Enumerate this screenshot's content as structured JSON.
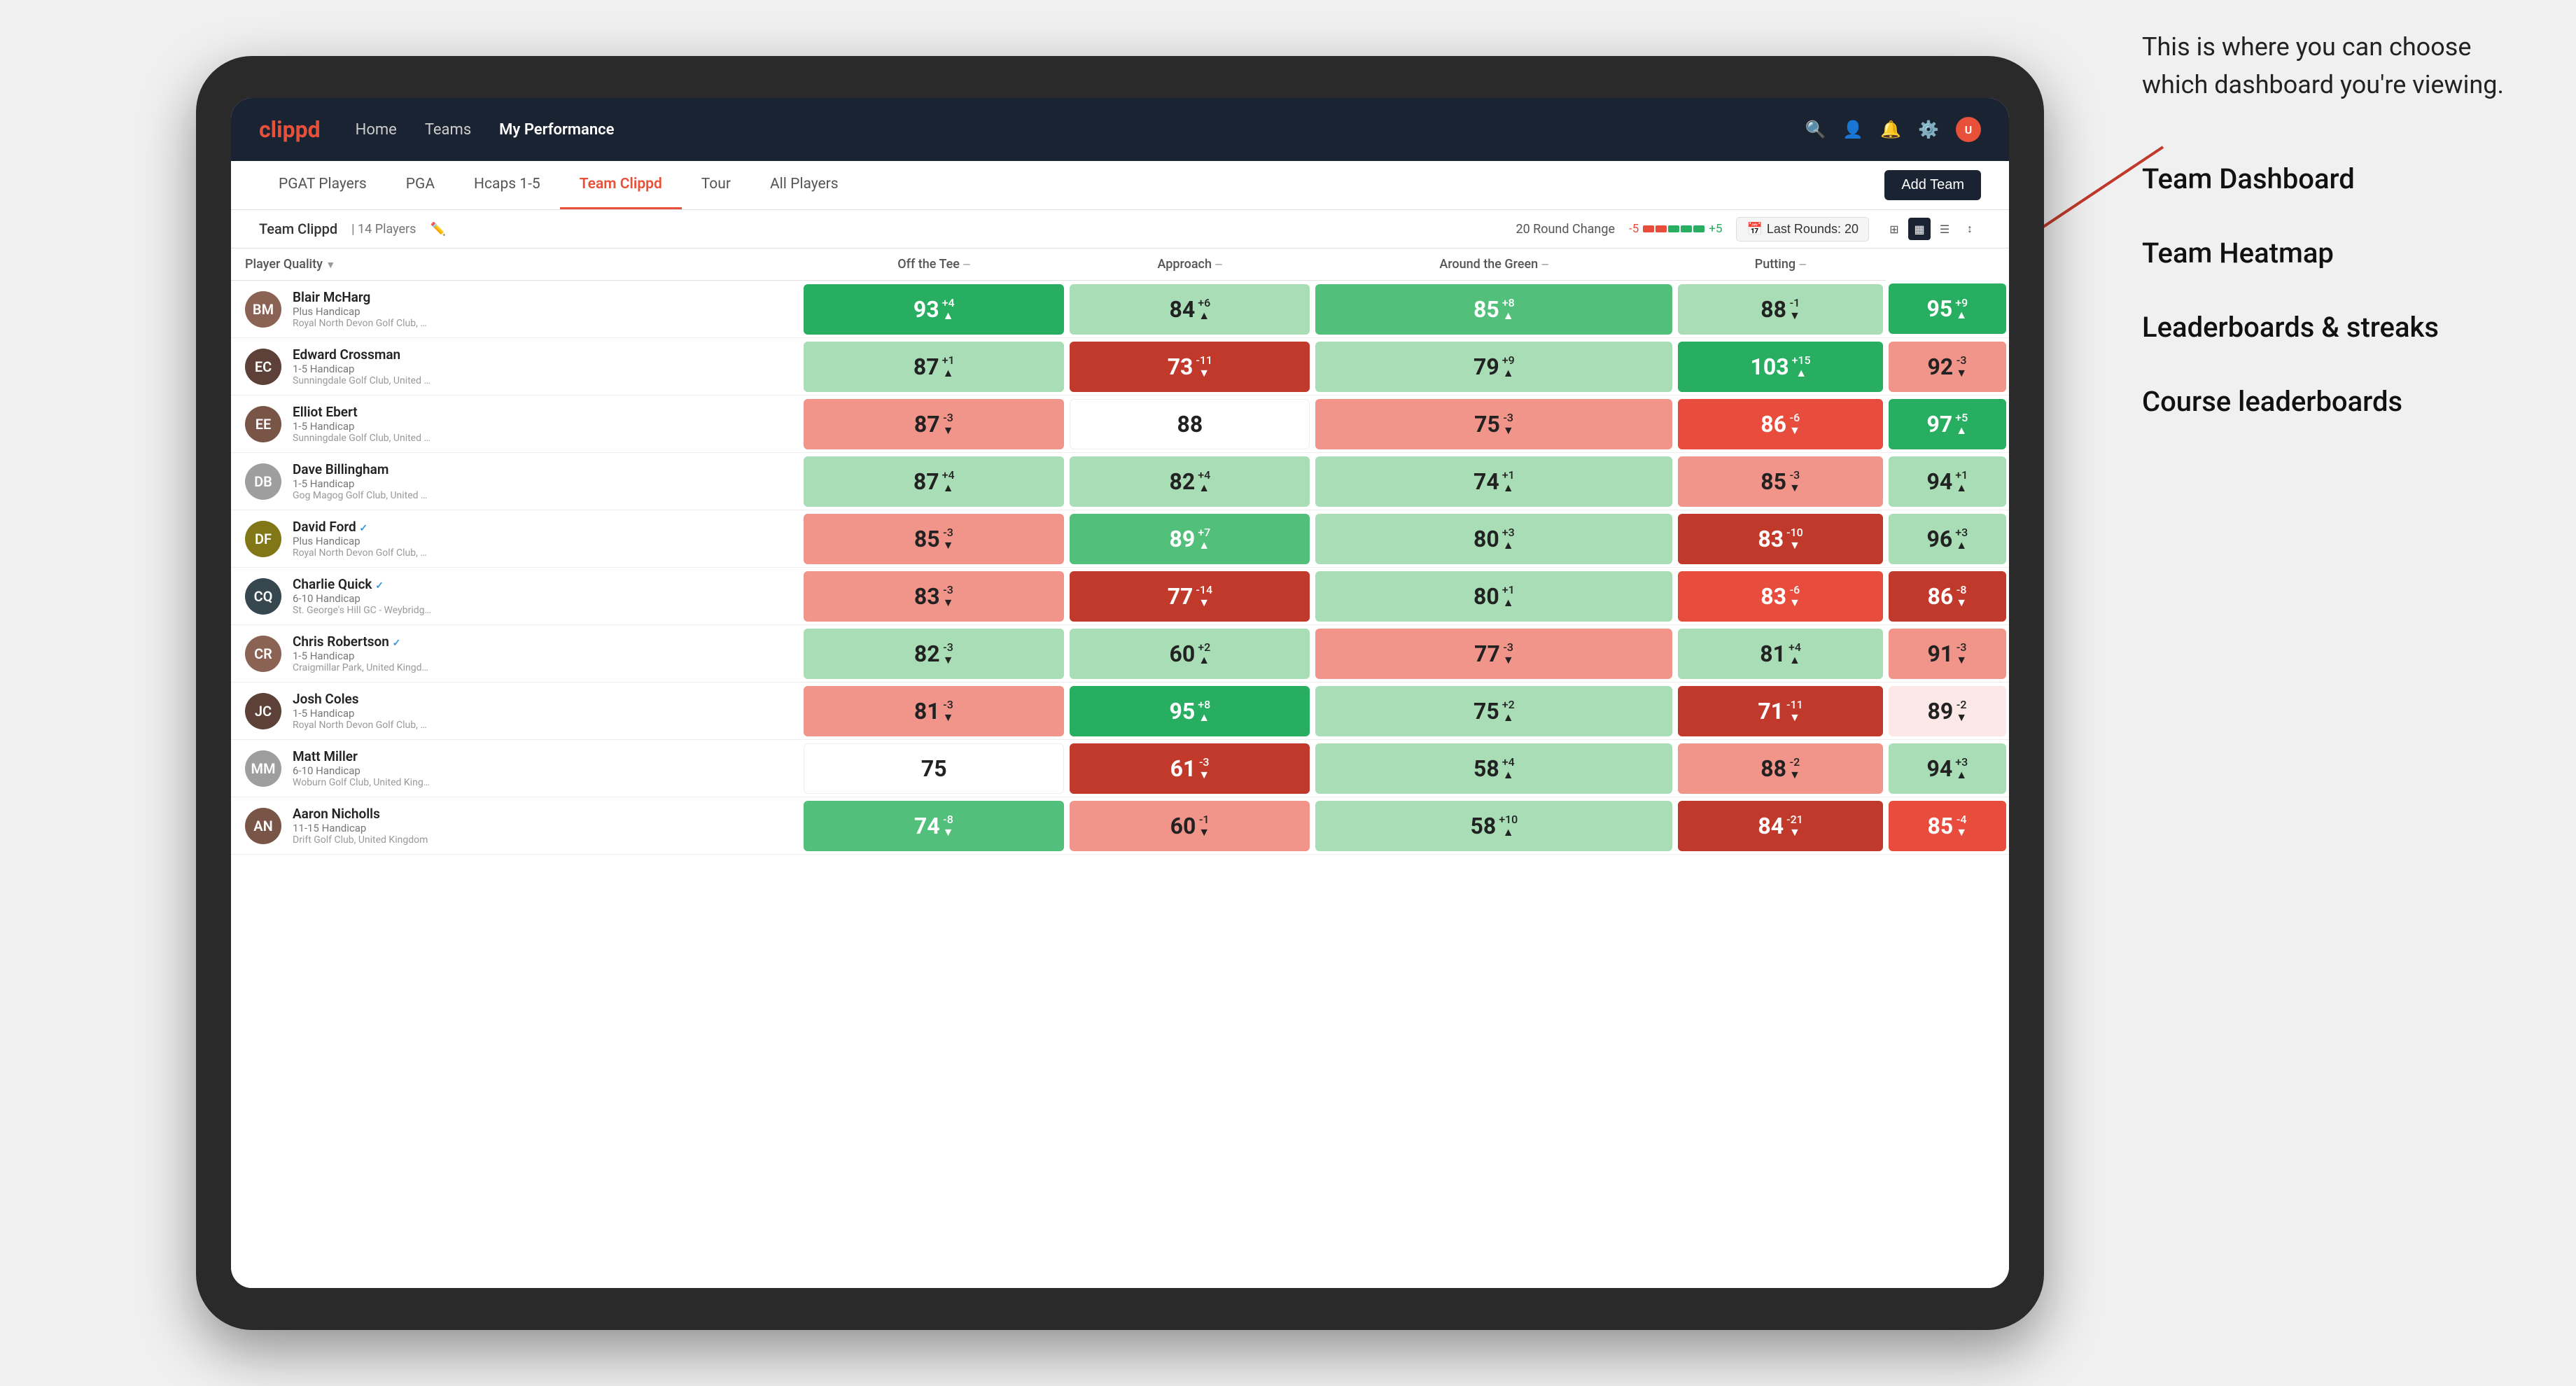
{
  "annotation": {
    "intro": "This is where you can choose which dashboard you're viewing.",
    "items": [
      "Team Dashboard",
      "Team Heatmap",
      "Leaderboards & streaks",
      "Course leaderboards"
    ]
  },
  "nav": {
    "logo": "clippd",
    "links": [
      "Home",
      "Teams",
      "My Performance"
    ],
    "active_link": "My Performance"
  },
  "sub_tabs": [
    "PGAT Players",
    "PGA",
    "Hcaps 1-5",
    "Team Clippd",
    "Tour",
    "All Players"
  ],
  "active_sub_tab": "Team Clippd",
  "add_team_label": "Add Team",
  "team_header": {
    "name": "Team Clippd",
    "count": "14 Players",
    "round_change_label": "20 Round Change",
    "change_neg": "-5",
    "change_pos": "+5",
    "last_rounds_label": "Last Rounds: 20"
  },
  "columns": {
    "player": "Player Quality",
    "off_tee": "Off the Tee",
    "approach": "Approach",
    "around_green": "Around the Green",
    "putting": "Putting"
  },
  "players": [
    {
      "name": "Blair McHarg",
      "handicap": "Plus Handicap",
      "club": "Royal North Devon Golf Club, United Kingdom",
      "avatar_color": "av-brown",
      "initials": "BM",
      "player_quality": {
        "value": 93,
        "change": "+4",
        "dir": "up",
        "color": "green-dark"
      },
      "off_tee": {
        "value": 84,
        "change": "+6",
        "dir": "up",
        "color": "green-light"
      },
      "approach": {
        "value": 85,
        "change": "+8",
        "dir": "up",
        "color": "green-med"
      },
      "around_green": {
        "value": 88,
        "change": "-1",
        "dir": "down",
        "color": "green-light"
      },
      "putting": {
        "value": 95,
        "change": "+9",
        "dir": "up",
        "color": "green-dark"
      }
    },
    {
      "name": "Edward Crossman",
      "handicap": "1-5 Handicap",
      "club": "Sunningdale Golf Club, United Kingdom",
      "avatar_color": "av-dark",
      "initials": "EC",
      "player_quality": {
        "value": 87,
        "change": "+1",
        "dir": "up",
        "color": "green-light"
      },
      "off_tee": {
        "value": 73,
        "change": "-11",
        "dir": "down",
        "color": "red-dark"
      },
      "approach": {
        "value": 79,
        "change": "+9",
        "dir": "up",
        "color": "green-light"
      },
      "around_green": {
        "value": 103,
        "change": "+15",
        "dir": "up",
        "color": "green-dark"
      },
      "putting": {
        "value": 92,
        "change": "-3",
        "dir": "down",
        "color": "red-light"
      }
    },
    {
      "name": "Elliot Ebert",
      "handicap": "1-5 Handicap",
      "club": "Sunningdale Golf Club, United Kingdom",
      "avatar_color": "av-medium",
      "initials": "EE",
      "player_quality": {
        "value": 87,
        "change": "-3",
        "dir": "down",
        "color": "red-light"
      },
      "off_tee": {
        "value": 88,
        "change": "",
        "dir": "",
        "color": "white"
      },
      "approach": {
        "value": 75,
        "change": "-3",
        "dir": "down",
        "color": "red-light"
      },
      "around_green": {
        "value": 86,
        "change": "-6",
        "dir": "down",
        "color": "red-med"
      },
      "putting": {
        "value": 97,
        "change": "+5",
        "dir": "up",
        "color": "green-dark"
      }
    },
    {
      "name": "Dave Billingham",
      "handicap": "1-5 Handicap",
      "club": "Gog Magog Golf Club, United Kingdom",
      "avatar_color": "av-gray",
      "initials": "DB",
      "player_quality": {
        "value": 87,
        "change": "+4",
        "dir": "up",
        "color": "green-light"
      },
      "off_tee": {
        "value": 82,
        "change": "+4",
        "dir": "up",
        "color": "green-light"
      },
      "approach": {
        "value": 74,
        "change": "+1",
        "dir": "up",
        "color": "green-light"
      },
      "around_green": {
        "value": 85,
        "change": "-3",
        "dir": "down",
        "color": "red-light"
      },
      "putting": {
        "value": 94,
        "change": "+1",
        "dir": "up",
        "color": "green-light"
      }
    },
    {
      "name": "David Ford",
      "handicap": "Plus Handicap",
      "club": "Royal North Devon Golf Club, United Kingdom",
      "avatar_color": "av-olive",
      "initials": "DF",
      "verified": true,
      "player_quality": {
        "value": 85,
        "change": "-3",
        "dir": "down",
        "color": "red-light"
      },
      "off_tee": {
        "value": 89,
        "change": "+7",
        "dir": "up",
        "color": "green-med"
      },
      "approach": {
        "value": 80,
        "change": "+3",
        "dir": "up",
        "color": "green-light"
      },
      "around_green": {
        "value": 83,
        "change": "-10",
        "dir": "down",
        "color": "red-dark"
      },
      "putting": {
        "value": 96,
        "change": "+3",
        "dir": "up",
        "color": "green-light"
      }
    },
    {
      "name": "Charlie Quick",
      "handicap": "6-10 Handicap",
      "club": "St. George's Hill GC - Weybridge - Surrey, Uni...",
      "avatar_color": "av-blue",
      "initials": "CQ",
      "verified": true,
      "player_quality": {
        "value": 83,
        "change": "-3",
        "dir": "down",
        "color": "red-light"
      },
      "off_tee": {
        "value": 77,
        "change": "-14",
        "dir": "down",
        "color": "red-dark"
      },
      "approach": {
        "value": 80,
        "change": "+1",
        "dir": "up",
        "color": "green-light"
      },
      "around_green": {
        "value": 83,
        "change": "-6",
        "dir": "down",
        "color": "red-med"
      },
      "putting": {
        "value": 86,
        "change": "-8",
        "dir": "down",
        "color": "red-dark"
      }
    },
    {
      "name": "Chris Robertson",
      "handicap": "1-5 Handicap",
      "club": "Craigmillar Park, United Kingdom",
      "avatar_color": "av-brown",
      "initials": "CR",
      "verified": true,
      "player_quality": {
        "value": 82,
        "change": "-3",
        "dir": "down",
        "color": "green-light"
      },
      "off_tee": {
        "value": 60,
        "change": "+2",
        "dir": "up",
        "color": "green-light"
      },
      "approach": {
        "value": 77,
        "change": "-3",
        "dir": "down",
        "color": "red-light"
      },
      "around_green": {
        "value": 81,
        "change": "+4",
        "dir": "up",
        "color": "green-light"
      },
      "putting": {
        "value": 91,
        "change": "-3",
        "dir": "down",
        "color": "red-light"
      }
    },
    {
      "name": "Josh Coles",
      "handicap": "1-5 Handicap",
      "club": "Royal North Devon Golf Club, United Kingdom",
      "avatar_color": "av-dark",
      "initials": "JC",
      "player_quality": {
        "value": 81,
        "change": "-3",
        "dir": "down",
        "color": "red-light"
      },
      "off_tee": {
        "value": 95,
        "change": "+8",
        "dir": "up",
        "color": "green-dark"
      },
      "approach": {
        "value": 75,
        "change": "+2",
        "dir": "up",
        "color": "green-light"
      },
      "around_green": {
        "value": 71,
        "change": "-11",
        "dir": "down",
        "color": "red-dark"
      },
      "putting": {
        "value": 89,
        "change": "-2",
        "dir": "down",
        "color": "pink-light"
      }
    },
    {
      "name": "Matt Miller",
      "handicap": "6-10 Handicap",
      "club": "Woburn Golf Club, United Kingdom",
      "avatar_color": "av-gray",
      "initials": "MM",
      "player_quality": {
        "value": 75,
        "change": "",
        "dir": "",
        "color": "white"
      },
      "off_tee": {
        "value": 61,
        "change": "-3",
        "dir": "down",
        "color": "red-dark"
      },
      "approach": {
        "value": 58,
        "change": "+4",
        "dir": "up",
        "color": "green-light"
      },
      "around_green": {
        "value": 88,
        "change": "-2",
        "dir": "down",
        "color": "red-light"
      },
      "putting": {
        "value": 94,
        "change": "+3",
        "dir": "up",
        "color": "green-light"
      }
    },
    {
      "name": "Aaron Nicholls",
      "handicap": "11-15 Handicap",
      "club": "Drift Golf Club, United Kingdom",
      "avatar_color": "av-medium",
      "initials": "AN",
      "player_quality": {
        "value": 74,
        "change": "-8",
        "dir": "down",
        "color": "green-med"
      },
      "off_tee": {
        "value": 60,
        "change": "-1",
        "dir": "down",
        "color": "red-light"
      },
      "approach": {
        "value": 58,
        "change": "+10",
        "dir": "up",
        "color": "green-light"
      },
      "around_green": {
        "value": 84,
        "change": "-21",
        "dir": "down",
        "color": "red-dark"
      },
      "putting": {
        "value": 85,
        "change": "-4",
        "dir": "down",
        "color": "red-med"
      }
    }
  ]
}
